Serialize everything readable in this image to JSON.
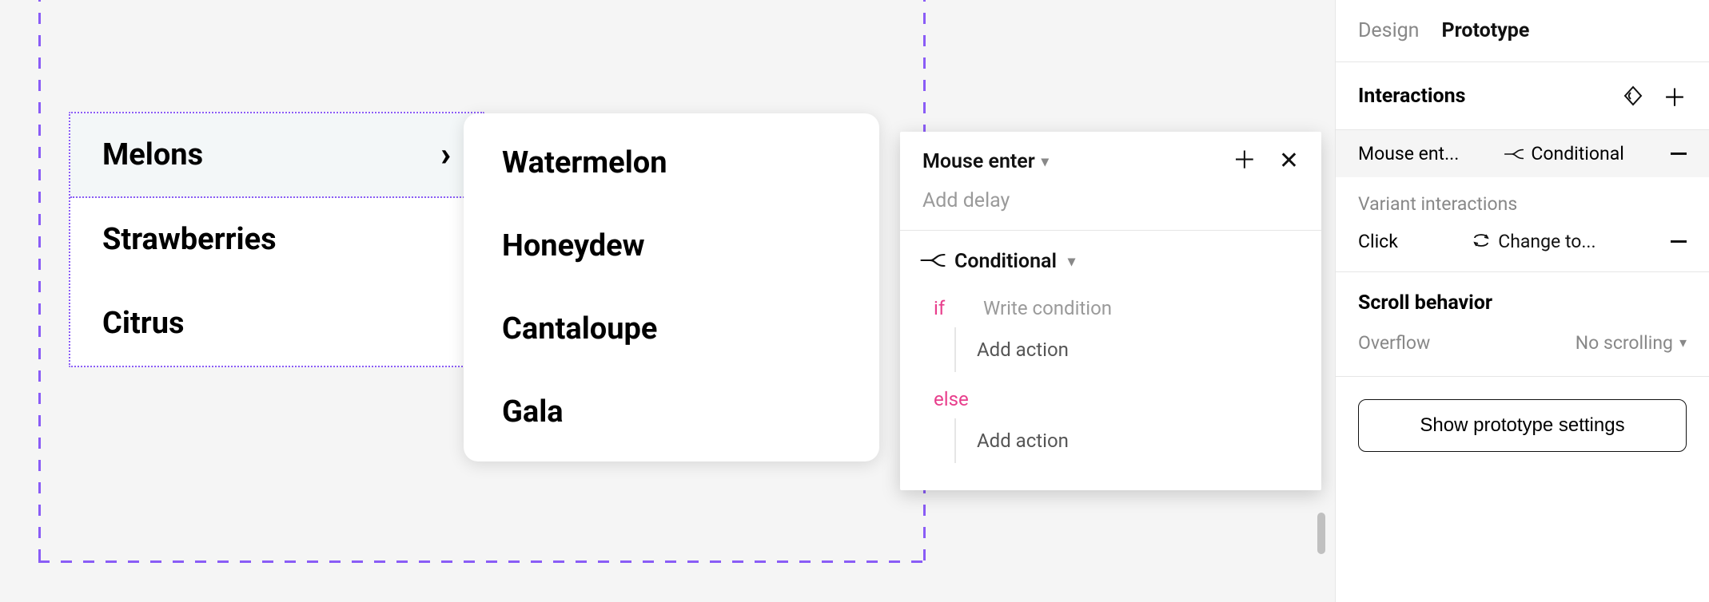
{
  "canvas": {
    "menu1": {
      "items": [
        {
          "label": "Melons",
          "selected": true,
          "has_chevron": true
        },
        {
          "label": "Strawberries"
        },
        {
          "label": "Citrus"
        }
      ]
    },
    "menu2": {
      "items": [
        {
          "label": "Watermelon"
        },
        {
          "label": "Honeydew"
        },
        {
          "label": "Cantaloupe"
        },
        {
          "label": "Gala"
        }
      ]
    }
  },
  "popover": {
    "trigger": "Mouse enter",
    "add_delay": "Add delay",
    "action_type": "Conditional",
    "if_kw": "if",
    "if_placeholder": "Write condition",
    "add_action": "Add action",
    "else_kw": "else"
  },
  "panel": {
    "tabs": {
      "design": "Design",
      "prototype": "Prototype"
    },
    "interactions": {
      "title": "Interactions",
      "row": {
        "trigger": "Mouse ent...",
        "action": "Conditional"
      }
    },
    "variants": {
      "title": "Variant interactions",
      "row": {
        "trigger": "Click",
        "action": "Change to..."
      }
    },
    "scroll": {
      "title": "Scroll behavior",
      "label": "Overflow",
      "value": "No scrolling"
    },
    "prototype_btn": "Show prototype settings"
  }
}
